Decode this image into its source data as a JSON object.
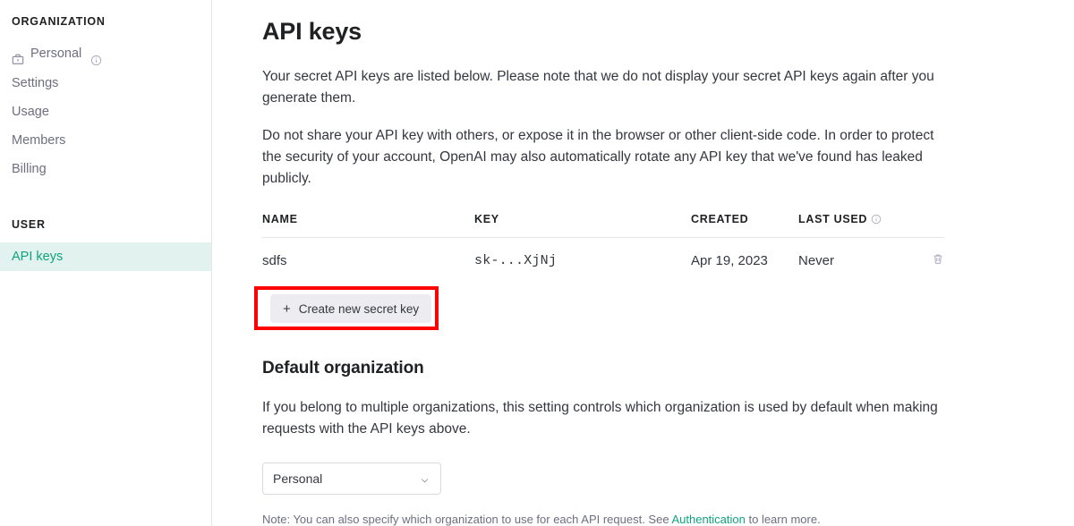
{
  "sidebar": {
    "org_section_label": "ORGANIZATION",
    "org_item": {
      "label": "Personal",
      "briefcase_icon": "briefcase-icon",
      "info_icon": "info-icon"
    },
    "org_links": [
      {
        "label": "Settings"
      },
      {
        "label": "Usage"
      },
      {
        "label": "Members"
      },
      {
        "label": "Billing"
      }
    ],
    "user_section_label": "USER",
    "user_links": [
      {
        "label": "API keys",
        "active": true
      }
    ],
    "active_bg_color": "#e2f2ee",
    "active_text_color": "#10a37f"
  },
  "main": {
    "title": "API keys",
    "paragraph_1": "Your secret API keys are listed below. Please note that we do not display your secret API keys again after you generate them.",
    "paragraph_2": "Do not share your API key with others, or expose it in the browser or other client-side code. In order to protect the security of your account, OpenAI may also automatically rotate any API key that we've found has leaked publicly.",
    "table": {
      "columns": [
        "NAME",
        "KEY",
        "CREATED",
        "LAST USED"
      ],
      "last_used_info_icon": "info-icon",
      "rows": [
        {
          "name": "sdfs",
          "key": "sk-...XjNj",
          "created": "Apr 19, 2023",
          "last_used": "Never",
          "delete_icon": "trash-icon"
        }
      ]
    },
    "create_button": {
      "label": "Create new secret key",
      "plus_icon": "plus-icon",
      "highlight_color": "#ff0000",
      "background_color": "#ececf1"
    },
    "default_org": {
      "title": "Default organization",
      "description": "If you belong to multiple organizations, this setting controls which organization is used by default when making requests with the API keys above.",
      "selected_option": "Personal",
      "options": [
        "Personal"
      ],
      "chevron_icon": "chevron-down-icon"
    },
    "note": {
      "before_link": "Note: You can also specify which organization to use for each API request. See ",
      "link_text": "Authentication",
      "after_link": " to learn more.",
      "link_color": "#10a37f"
    }
  }
}
